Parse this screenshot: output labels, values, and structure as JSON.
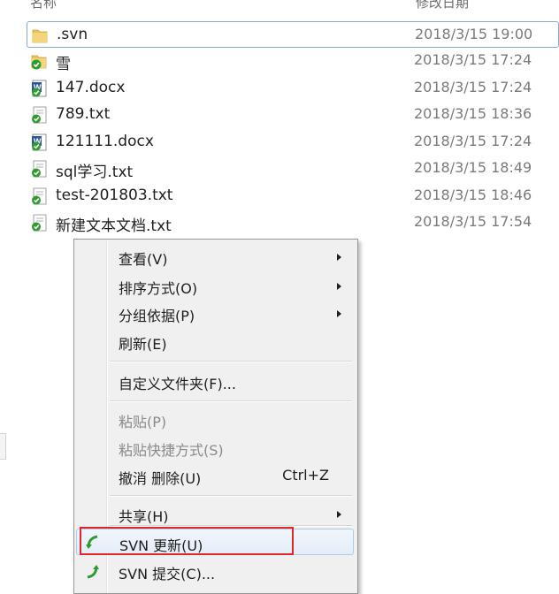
{
  "header": {
    "name_col": "名称",
    "date_col": "修改日期"
  },
  "files": [
    {
      "name": ".svn",
      "date": "2018/3/15 19:00",
      "icon": "folder-icon"
    },
    {
      "name": "雪",
      "date": "2018/3/15 17:24",
      "icon": "svn-folder-icon"
    },
    {
      "name": "147.docx",
      "date": "2018/3/15 17:24",
      "icon": "svn-word-doc-icon"
    },
    {
      "name": "789.txt",
      "date": "2018/3/15 18:36",
      "icon": "svn-text-file-icon"
    },
    {
      "name": "121111.docx",
      "date": "2018/3/15 17:24",
      "icon": "svn-word-doc-icon"
    },
    {
      "name": "sql学习.txt",
      "date": "2018/3/15 18:49",
      "icon": "svn-text-file-icon"
    },
    {
      "name": "test-201803.txt",
      "date": "2018/3/15 18:46",
      "icon": "svn-text-file-icon"
    },
    {
      "name": "新建文本文档.txt",
      "date": "2018/3/15 17:54",
      "icon": "svn-text-file-icon"
    }
  ],
  "menu": {
    "view": "查看(V)",
    "sort": "排序方式(O)",
    "group": "分组依据(P)",
    "refresh": "刷新(E)",
    "customize": "自定义文件夹(F)...",
    "paste": "粘贴(P)",
    "paste_shortcut": "粘贴快捷方式(S)",
    "undo_delete": "撤消 删除(U)",
    "undo_shortcut": "Ctrl+Z",
    "share": "共享(H)",
    "svn_update": "SVN 更新(U)",
    "svn_commit": "SVN 提交(C)..."
  },
  "colors": {
    "svn_green": "#2e9b2e",
    "word_blue": "#2b5797",
    "folder_yellow": "#e8c25a",
    "highlight_red": "#e0262b"
  }
}
